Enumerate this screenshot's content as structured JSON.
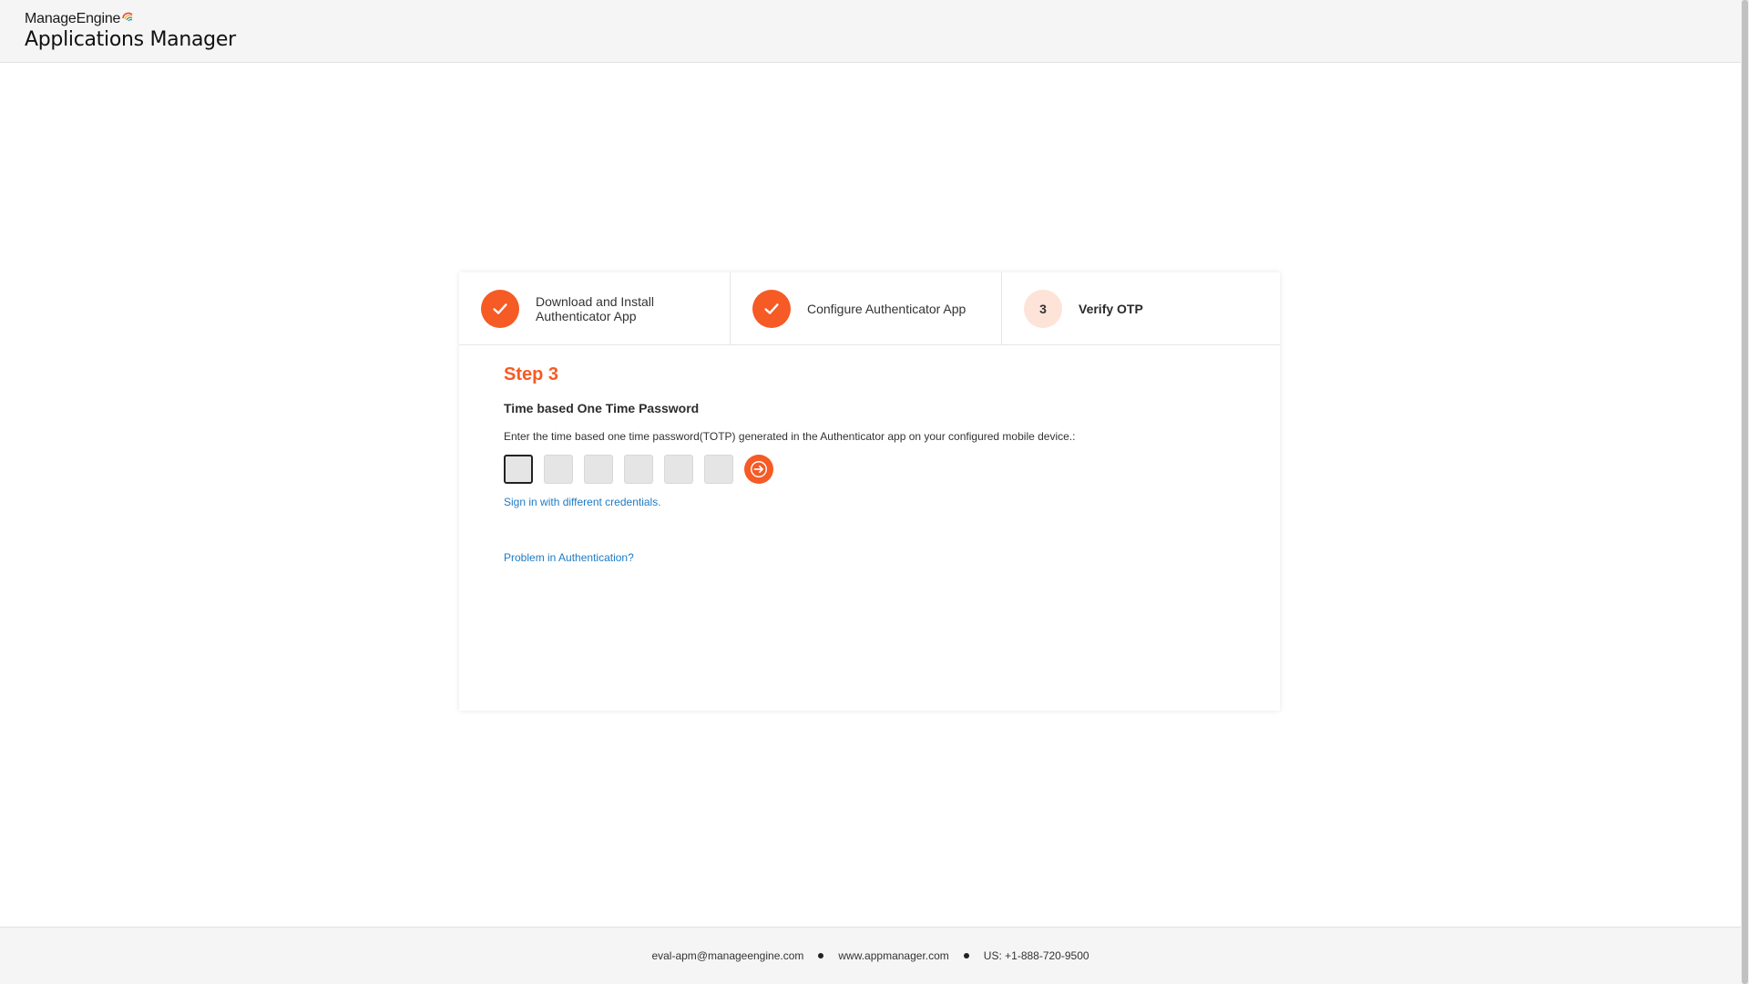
{
  "header": {
    "brand": "ManageEngine",
    "product": "Applications Manager"
  },
  "steps": [
    {
      "label": "Download and Install Authenticator App",
      "status": "completed",
      "icon": "check-icon"
    },
    {
      "label": "Configure Authenticator App",
      "status": "completed",
      "icon": "check-icon"
    },
    {
      "label": "Verify OTP",
      "status": "current",
      "number": "3"
    }
  ],
  "content": {
    "step_title": "Step 3",
    "heading": "Time based One Time Password",
    "instruction": "Enter the time based one time password(TOTP) generated in the Authenticator app on your configured mobile device.:",
    "otp_digits": [
      "",
      "",
      "",
      "",
      "",
      ""
    ],
    "submit_icon": "arrow-right-icon",
    "alt_signin_link": "Sign in with different credentials.",
    "problem_link": "Problem in Authentication?"
  },
  "footer": {
    "email": "eval-apm@manageengine.com",
    "website": "www.appmanager.com",
    "phone": "US: +1-888-720-9500"
  },
  "colors": {
    "accent": "#f65a25",
    "accent_light": "#fde3d8",
    "link": "#1e7bc4",
    "header_bg": "#f5f5f5"
  }
}
